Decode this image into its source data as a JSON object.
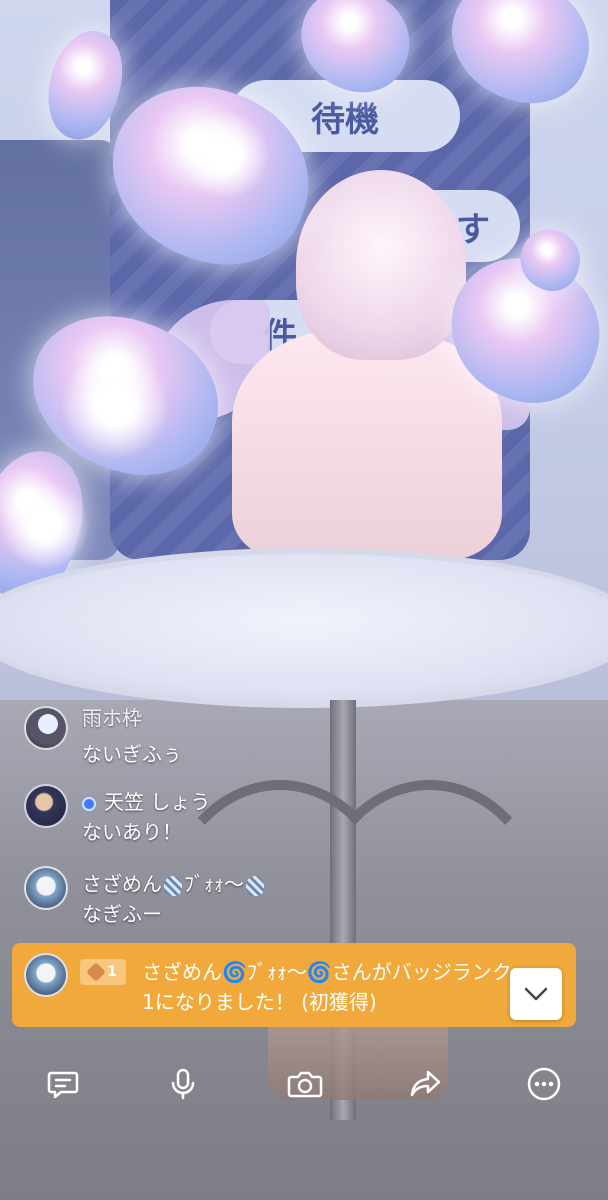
{
  "stream_background": {
    "board_texts": [
      "待機",
      "す",
      "件"
    ]
  },
  "chat": {
    "messages": [
      {
        "username": "雨ホ枠",
        "text": "ないぎふぅ",
        "verified": false
      },
      {
        "username": "天笠 しょう",
        "text": "ないあり！",
        "verified": true
      },
      {
        "username": "さざめん",
        "username_suffix": "ﾌﾞｫｫ～",
        "text": "なぎふー",
        "verified": false
      }
    ]
  },
  "badge_notice": {
    "rank": "1",
    "text": "さざめん🌀ﾌﾞｫｫ～🌀さんがバッジランク1になりました！ (初獲得)",
    "color": "#f0a93a"
  },
  "toolbar": {
    "items": [
      {
        "icon": "comment-icon"
      },
      {
        "icon": "microphone-icon"
      },
      {
        "icon": "camera-icon"
      },
      {
        "icon": "share-icon"
      },
      {
        "icon": "more-icon"
      }
    ]
  },
  "scroll_down": {
    "icon": "chevron-down-icon"
  }
}
